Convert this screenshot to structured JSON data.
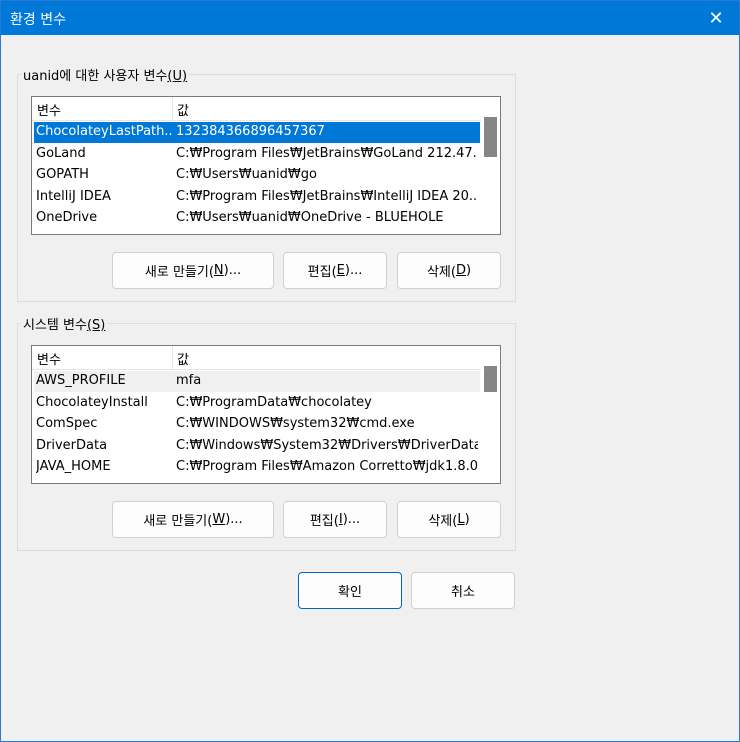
{
  "window": {
    "title": "환경 변수",
    "close_glyph": "✕"
  },
  "user_vars": {
    "label": "uanid에 대한 사용자 변수",
    "label_key": "(U)",
    "col_name": "변수",
    "col_value": "값",
    "rows": [
      {
        "name": "ChocolateyLastPath...",
        "value": "132384366896457367"
      },
      {
        "name": "GoLand",
        "value": "C:₩Program Files₩JetBrains₩GoLand 212.47..."
      },
      {
        "name": "GOPATH",
        "value": "C:₩Users₩uanid₩go"
      },
      {
        "name": "IntelliJ IDEA",
        "value": "C:₩Program Files₩JetBrains₩IntelliJ IDEA 20..."
      },
      {
        "name": "OneDrive",
        "value": "C:₩Users₩uanid₩OneDrive - BLUEHOLE"
      }
    ],
    "new_label": "새로 만들기(",
    "new_key": "N",
    "new_suffix": ")...",
    "edit_label": "편집(",
    "edit_key": "E",
    "edit_suffix": ")...",
    "delete_label": "삭제(",
    "delete_key": "D",
    "delete_suffix": ")"
  },
  "system_vars": {
    "label": "시스템 변수",
    "label_key": "(S)",
    "col_name": "변수",
    "col_value": "값",
    "rows": [
      {
        "name": "AWS_PROFILE",
        "value": "mfa"
      },
      {
        "name": "ChocolateyInstall",
        "value": "C:₩ProgramData₩chocolatey"
      },
      {
        "name": "ComSpec",
        "value": "C:₩WINDOWS₩system32₩cmd.exe"
      },
      {
        "name": "DriverData",
        "value": "C:₩Windows₩System32₩Drivers₩DriverData"
      },
      {
        "name": "JAVA_HOME",
        "value": "C:₩Program Files₩Amazon Corretto₩jdk1.8.0..."
      }
    ],
    "new_label": "새로 만들기(",
    "new_key": "W",
    "new_suffix": ")...",
    "edit_label": "편집(",
    "edit_key": "I",
    "edit_suffix": ")...",
    "delete_label": "삭제(",
    "delete_key": "L",
    "delete_suffix": ")"
  },
  "footer": {
    "ok_label": "확인",
    "cancel_label": "취소"
  },
  "colors": {
    "accent": "#0078d7",
    "selected_row": "#0078d7",
    "hover_row": "#f0f0f0"
  }
}
